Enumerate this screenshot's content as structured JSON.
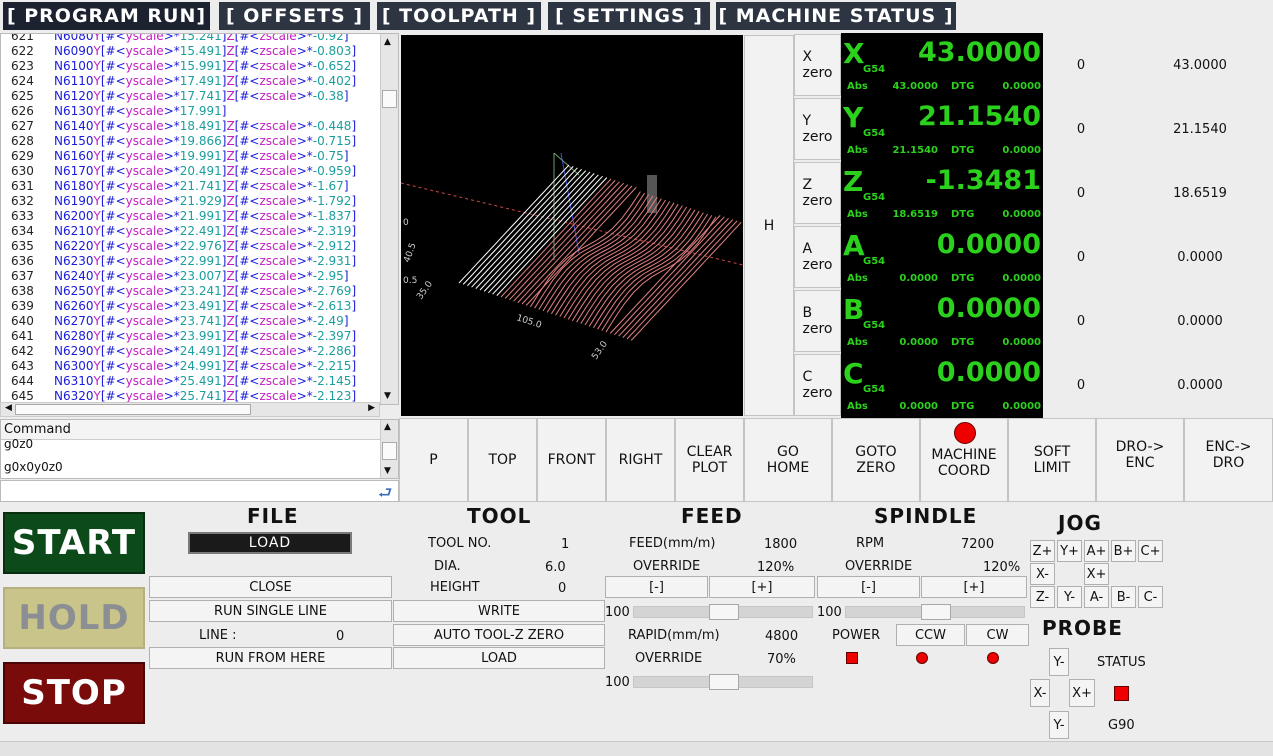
{
  "tabs": [
    "[ PROGRAM RUN]",
    "[ OFFSETS ]",
    "[ TOOLPATH ]",
    "[ SETTINGS ]",
    "[ MACHINE STATUS ]"
  ],
  "gcode": [
    {
      "n": "621",
      "t": "N6080Y[#<yscale>*15.241]Z[#<zscale>*-0.92]"
    },
    {
      "n": "622",
      "t": "N6090Y[#<yscale>*15.491]Z[#<zscale>*-0.803]"
    },
    {
      "n": "623",
      "t": "N6100Y[#<yscale>*15.991]Z[#<zscale>*-0.652]"
    },
    {
      "n": "624",
      "t": "N6110Y[#<yscale>*17.491]Z[#<zscale>*-0.402]"
    },
    {
      "n": "625",
      "t": "N6120Y[#<yscale>*17.741]Z[#<zscale>*-0.38]"
    },
    {
      "n": "626",
      "t": "N6130Y[#<yscale>*17.991]"
    },
    {
      "n": "627",
      "t": "N6140Y[#<yscale>*18.491]Z[#<zscale>*-0.448]"
    },
    {
      "n": "628",
      "t": "N6150Y[#<yscale>*19.866]Z[#<zscale>*-0.715]"
    },
    {
      "n": "629",
      "t": "N6160Y[#<yscale>*19.991]Z[#<zscale>*-0.75]"
    },
    {
      "n": "630",
      "t": "N6170Y[#<yscale>*20.491]Z[#<zscale>*-0.959]"
    },
    {
      "n": "631",
      "t": "N6180Y[#<yscale>*21.741]Z[#<zscale>*-1.67]"
    },
    {
      "n": "632",
      "t": "N6190Y[#<yscale>*21.929]Z[#<zscale>*-1.792]"
    },
    {
      "n": "633",
      "t": "N6200Y[#<yscale>*21.991]Z[#<zscale>*-1.837]"
    },
    {
      "n": "634",
      "t": "N6210Y[#<yscale>*22.491]Z[#<zscale>*-2.319]"
    },
    {
      "n": "635",
      "t": "N6220Y[#<yscale>*22.976]Z[#<zscale>*-2.912]"
    },
    {
      "n": "636",
      "t": "N6230Y[#<yscale>*22.991]Z[#<zscale>*-2.931]"
    },
    {
      "n": "637",
      "t": "N6240Y[#<yscale>*23.007]Z[#<zscale>*-2.95]"
    },
    {
      "n": "638",
      "t": "N6250Y[#<yscale>*23.241]Z[#<zscale>*-2.769]"
    },
    {
      "n": "639",
      "t": "N6260Y[#<yscale>*23.491]Z[#<zscale>*-2.613]"
    },
    {
      "n": "640",
      "t": "N6270Y[#<yscale>*23.741]Z[#<zscale>*-2.49]"
    },
    {
      "n": "641",
      "t": "N6280Y[#<yscale>*23.991]Z[#<zscale>*-2.397]"
    },
    {
      "n": "642",
      "t": "N6290Y[#<yscale>*24.491]Z[#<zscale>*-2.286]"
    },
    {
      "n": "643",
      "t": "N6300Y[#<yscale>*24.991]Z[#<zscale>*-2.215]"
    },
    {
      "n": "644",
      "t": "N6310Y[#<yscale>*25.491]Z[#<zscale>*-2.145]"
    },
    {
      "n": "645",
      "t": "N6320Y[#<yscale>*25.741]Z[#<zscale>*-2.123]"
    }
  ],
  "command": {
    "header": "Command",
    "history": [
      "g0z0",
      "g0x0y0z0"
    ],
    "input_value": ""
  },
  "view3d_labels": [
    "105.0",
    "53.0",
    "35.0",
    "40.5",
    "0.5",
    "0"
  ],
  "home_button": "H",
  "dro": {
    "axes": [
      {
        "name": "X",
        "zero": "X\nzero",
        "wcs": "G54",
        "value": "43.0000",
        "abs": "43.0000",
        "dtg": "0.0000",
        "col1": "0",
        "col2": "43.0000"
      },
      {
        "name": "Y",
        "zero": "Y\nzero",
        "wcs": "G54",
        "value": "21.1540",
        "abs": "21.1540",
        "dtg": "0.0000",
        "col1": "0",
        "col2": "21.1540"
      },
      {
        "name": "Z",
        "zero": "Z\nzero",
        "wcs": "G54",
        "value": "-1.3481",
        "abs": "18.6519",
        "dtg": "0.0000",
        "col1": "0",
        "col2": "18.6519"
      },
      {
        "name": "A",
        "zero": "A\nzero",
        "wcs": "G54",
        "value": "0.0000",
        "abs": "0.0000",
        "dtg": "0.0000",
        "col1": "0",
        "col2": "0.0000"
      },
      {
        "name": "B",
        "zero": "B\nzero",
        "wcs": "G54",
        "value": "0.0000",
        "abs": "0.0000",
        "dtg": "0.0000",
        "col1": "0",
        "col2": "0.0000"
      },
      {
        "name": "C",
        "zero": "C\nzero",
        "wcs": "G54",
        "value": "0.0000",
        "abs": "0.0000",
        "dtg": "0.0000",
        "col1": "0",
        "col2": "0.0000"
      }
    ],
    "abs_label": "Abs",
    "dtg_label": "DTG"
  },
  "toolbar": [
    "P",
    "TOP",
    "FRONT",
    "RIGHT",
    "CLEAR\nPLOT",
    "GO\nHOME",
    "GOTO\nZERO",
    "MACHINE\nCOORD",
    "SOFT\nLIMIT",
    "DRO->\nENC",
    "ENC->\nDRO"
  ],
  "main_buttons": {
    "start": "START",
    "hold": "HOLD",
    "stop": "STOP"
  },
  "file": {
    "title": "FILE",
    "load": "LOAD",
    "close": "CLOSE",
    "run_single": "RUN SINGLE LINE",
    "line_label": "LINE :",
    "line_value": "0",
    "run_from_here": "RUN FROM HERE"
  },
  "tool": {
    "title": "TOOL",
    "no_label": "TOOL NO.",
    "no_value": "1",
    "dia_label": "DIA.",
    "dia_value": "6.0",
    "height_label": "HEIGHT",
    "height_value": "0",
    "write": "WRITE",
    "auto_zero": "AUTO TOOL-Z ZERO",
    "load": "LOAD"
  },
  "feed": {
    "title": "FEED",
    "feed_label": "FEED(mm/m)",
    "feed_value": "1800",
    "override_label": "OVERRIDE",
    "override_value": "120%",
    "minus": "[-]",
    "plus": "[+]",
    "slider_min": "100",
    "slider_level": 0.5,
    "rapid_label": "RAPID(mm/m)",
    "rapid_value": "4800",
    "rapid_override_label": "OVERRIDE",
    "rapid_override_value": "70%",
    "rapid_slider_min": "100",
    "rapid_slider_level": 0.5
  },
  "spindle": {
    "title": "SPINDLE",
    "rpm_label": "RPM",
    "rpm_value": "7200",
    "override_label": "OVERRIDE",
    "override_value": "120%",
    "minus": "[-]",
    "plus": "[+]",
    "slider_min": "100",
    "slider_level": 0.5,
    "power_label": "POWER",
    "ccw": "CCW",
    "cw": "CW"
  },
  "jog": {
    "title": "JOG",
    "row1": [
      "Z+",
      "Y+",
      "A+",
      "B+",
      "C+"
    ],
    "x_minus": "X-",
    "x_plus": "X+",
    "row3": [
      "Z-",
      "Y-",
      "A-",
      "B-",
      "C-"
    ]
  },
  "probe": {
    "title": "PROBE",
    "y_plus": "Y-",
    "x_minus": "X-",
    "x_plus": "X+",
    "y_minus": "Y-",
    "status_label": "STATUS",
    "mode": "G90"
  },
  "colors": {
    "tab_bg": "#2d3442",
    "dro_green": "#2bd11c",
    "start": "#0d4a1a",
    "hold": "#c9c48a",
    "stop": "#7a0b0b",
    "led": "#e00000"
  }
}
